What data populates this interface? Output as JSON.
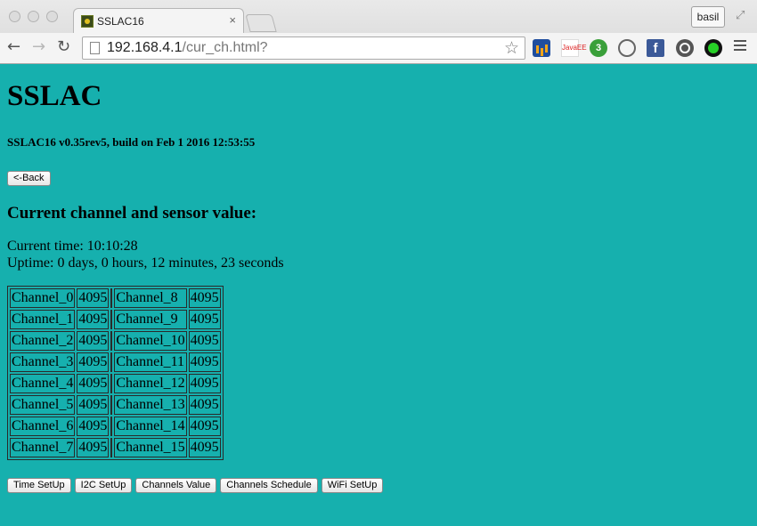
{
  "browser": {
    "tab_title": "SSLAC16",
    "tab_close": "×",
    "user": "basil",
    "url_host": "192.168.4.1",
    "url_path": "/cur_ch.html?",
    "nav": {
      "back": "←",
      "forward": "→",
      "reload": "↻"
    },
    "star": "☆",
    "ext_java_label": "JavaEE",
    "ext_badge_count": "3",
    "ext_facebook_label": "f"
  },
  "page": {
    "title": "SSLAC",
    "build_info": "SSLAC16 v0.35rev5, build on Feb 1 2016 12:53:55",
    "back_button": "<-Back",
    "section_heading": "Current channel and sensor value:",
    "current_time": "Current time: 10:10:28",
    "uptime": "Uptime: 0 days, 0 hours, 12 minutes, 23 seconds"
  },
  "channels": {
    "left": [
      {
        "name": "Channel_0",
        "value": "4095"
      },
      {
        "name": "Channel_1",
        "value": "4095"
      },
      {
        "name": "Channel_2",
        "value": "4095"
      },
      {
        "name": "Channel_3",
        "value": "4095"
      },
      {
        "name": "Channel_4",
        "value": "4095"
      },
      {
        "name": "Channel_5",
        "value": "4095"
      },
      {
        "name": "Channel_6",
        "value": "4095"
      },
      {
        "name": "Channel_7",
        "value": "4095"
      }
    ],
    "right": [
      {
        "name": "Channel_8",
        "value": "4095"
      },
      {
        "name": "Channel_9",
        "value": "4095"
      },
      {
        "name": "Channel_10",
        "value": "4095"
      },
      {
        "name": "Channel_11",
        "value": "4095"
      },
      {
        "name": "Channel_12",
        "value": "4095"
      },
      {
        "name": "Channel_13",
        "value": "4095"
      },
      {
        "name": "Channel_14",
        "value": "4095"
      },
      {
        "name": "Channel_15",
        "value": "4095"
      }
    ]
  },
  "footer_buttons": {
    "time_setup": "Time SetUp",
    "i2c_setup": "I2C SetUp",
    "channels_value": "Channels Value",
    "channels_schedule": "Channels Schedule",
    "wifi_setup": "WiFi SetUp"
  },
  "colors": {
    "page_background": "#16b0ae"
  }
}
